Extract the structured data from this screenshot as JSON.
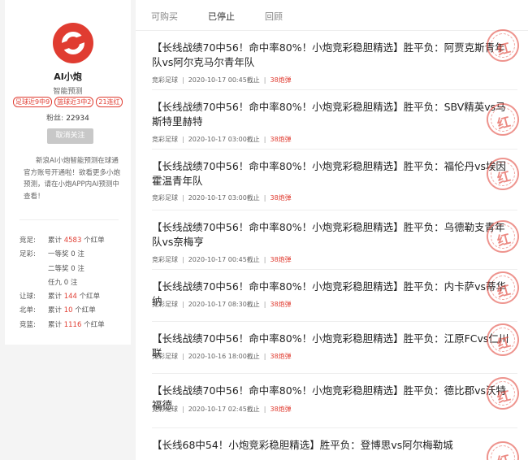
{
  "profile": {
    "name": "AI小炮",
    "subtitle": "智能预测",
    "tags": [
      "足球近9中9",
      "篮球近3中2",
      "21连红"
    ],
    "fans_label": "粉丝:",
    "fans_count": "22934",
    "follow_label": "取消关注",
    "description": "新浪AI小炮智能预测在球通官方账号开通啦！欲看更多小炮预测，请在小炮APP内AI预测中查看！",
    "stats": [
      {
        "label": "竞足:",
        "pre": "累计",
        "value": "4583",
        "post": "个红单"
      },
      {
        "label": "足彩:",
        "pre": "一等奖",
        "value": "0",
        "post": "注"
      },
      {
        "label": "",
        "pre": "二等奖",
        "value": "0",
        "post": "注"
      },
      {
        "label": "",
        "pre": "任九",
        "value": "0",
        "post": "注"
      },
      {
        "label": "让球:",
        "pre": "累计",
        "value": "144",
        "post": "个红单"
      },
      {
        "label": "北单:",
        "pre": "累计",
        "value": "10",
        "post": "个红单"
      },
      {
        "label": "竞篮:",
        "pre": "累计",
        "value": "1116",
        "post": "个红单"
      }
    ]
  },
  "tabs": [
    "可购买",
    "已停止",
    "回顾"
  ],
  "active_tab": "已停止",
  "items": [
    {
      "title": "【长线战绩70中56！命中率80%！小炮竞彩稳胆精选】胜平负：阿贾克斯青年队vs阿尔克马尔青年队",
      "category": "竞彩足球",
      "time": "2020-10-17 00:45截止",
      "count": "38炮弹"
    },
    {
      "title": "【长线战绩70中56！命中率80%！小炮竞彩稳胆精选】胜平负：SBV精英vs马斯特里赫特",
      "category": "竞彩足球",
      "time": "2020-10-17 03:00截止",
      "count": "38炮弹"
    },
    {
      "title": "【长线战绩70中56！命中率80%！小炮竞彩稳胆精选】胜平负：福伦丹vs埃因霍温青年队",
      "category": "竞彩足球",
      "time": "2020-10-17 03:00截止",
      "count": "38炮弹"
    },
    {
      "title": "【长线战绩70中56！命中率80%！小炮竞彩稳胆精选】胜平负：乌德勒支青年队vs奈梅亨",
      "category": "竞彩足球",
      "time": "2020-10-17 00:45截止",
      "count": "38炮弹"
    },
    {
      "title": "【长线战绩70中56！命中率80%！小炮竞彩稳胆精选】胜平负：内卡萨vs蒂华纳",
      "category": "竞彩足球",
      "time": "2020-10-17 08:30截止",
      "count": "38炮弹"
    },
    {
      "title": "【长线战绩70中56！命中率80%！小炮竞彩稳胆精选】胜平负：江原FCvs仁川联",
      "category": "竞彩足球",
      "time": "2020-10-16 18:00截止",
      "count": "38炮弹"
    },
    {
      "title": "【长线战绩70中56！命中率80%！小炮竞彩稳胆精选】胜平负：德比郡vs沃特福德",
      "category": "竞彩足球",
      "time": "2020-10-17 02:45截止",
      "count": "38炮弹"
    },
    {
      "title": "【长线68中54！小炮竞彩稳胆精选】胜平负：登博思vs阿尔梅勒城",
      "category": "竞彩足球",
      "time": "",
      "count": ""
    }
  ],
  "stamp_text": "红",
  "colors": {
    "accent": "#e03c31",
    "button_disabled": "#c8c8c8"
  }
}
